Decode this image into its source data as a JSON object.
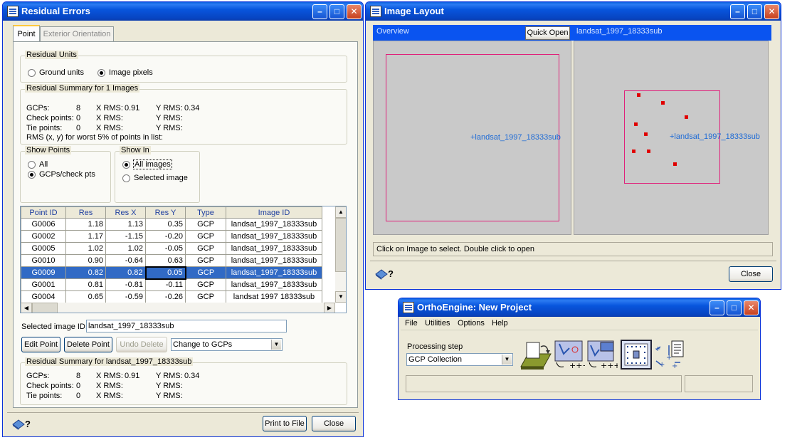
{
  "residual_window": {
    "title": "Residual Errors",
    "tabs": [
      "Point",
      "Exterior Orientation"
    ],
    "residual_units": {
      "label": "Residual Units",
      "options": [
        "Ground units",
        "Image pixels"
      ],
      "selected": "Image pixels"
    },
    "summary": {
      "label": "Residual Summary for 1 Images",
      "rows": [
        {
          "name": "GCPs:",
          "count": "8",
          "xrms": "X RMS:",
          "xval": "0.91",
          "yrms": "Y RMS:",
          "yval": "0.34"
        },
        {
          "name": "Check points:",
          "count": "0",
          "xrms": "X RMS:",
          "xval": "",
          "yrms": "Y RMS:",
          "yval": ""
        },
        {
          "name": "Tie points:",
          "count": "0",
          "xrms": "X RMS:",
          "xval": "",
          "yrms": "Y RMS:",
          "yval": ""
        }
      ],
      "worst_note": "RMS (x, y) for worst 5% of points in list:"
    },
    "show_points": {
      "label": "Show Points",
      "options": [
        "All",
        "GCPs/check pts"
      ],
      "selected": "GCPs/check pts"
    },
    "show_in": {
      "label": "Show In",
      "options": [
        "All images",
        "Selected image"
      ],
      "selected": "All images"
    },
    "table": {
      "columns": [
        "Point ID",
        "Res",
        "Res X",
        "Res Y",
        "Type",
        "Image ID"
      ],
      "rows": [
        [
          "G0006",
          "1.18",
          "1.13",
          "0.35",
          "GCP",
          "landsat_1997_18333sub"
        ],
        [
          "G0002",
          "1.17",
          "-1.15",
          "-0.20",
          "GCP",
          "landsat_1997_18333sub"
        ],
        [
          "G0005",
          "1.02",
          "1.02",
          "-0.05",
          "GCP",
          "landsat_1997_18333sub"
        ],
        [
          "G0010",
          "0.90",
          "-0.64",
          "0.63",
          "GCP",
          "landsat_1997_18333sub"
        ],
        [
          "G0009",
          "0.82",
          "0.82",
          "0.05",
          "GCP",
          "landsat_1997_18333sub"
        ],
        [
          "G0001",
          "0.81",
          "-0.81",
          "-0.11",
          "GCP",
          "landsat_1997_18333sub"
        ],
        [
          "G0004",
          "0.65",
          "-0.59",
          "-0.26",
          "GCP",
          "landsat 1997 18333sub"
        ]
      ],
      "selected_row": 4
    },
    "selected_image_label": "Selected image ID:",
    "selected_image_value": "landsat_1997_18333sub",
    "buttons": {
      "edit": "Edit Point",
      "delete": "Delete Point",
      "undo": "Undo Delete",
      "print": "Print to File",
      "close": "Close"
    },
    "change_combo": "Change to GCPs",
    "image_summary": {
      "label": "Residual Summary for landsat_1997_18333sub",
      "rows": [
        {
          "name": "GCPs:",
          "count": "8",
          "xrms": "X RMS:",
          "xval": "0.91",
          "yrms": "Y RMS:",
          "yval": "0.34"
        },
        {
          "name": "Check points:",
          "count": "0",
          "xrms": "X RMS:",
          "xval": "",
          "yrms": "Y RMS:",
          "yval": ""
        },
        {
          "name": "Tie points:",
          "count": "0",
          "xrms": "X RMS:",
          "xval": "",
          "yrms": "Y RMS:",
          "yval": ""
        }
      ]
    }
  },
  "layout_window": {
    "title": "Image Layout",
    "overview_label": "Overview",
    "quick_open": "Quick Open",
    "image_name": "landsat_1997_18333sub",
    "overview_image_label": "+landsat_1997_18333sub",
    "detail_image_label": "+landsat_1997_18333sub",
    "status": "Click on Image to select. Double click to open",
    "close": "Close"
  },
  "ortho_window": {
    "title": "OrthoEngine: New Project",
    "menu": [
      "File",
      "Utilities",
      "Options",
      "Help"
    ],
    "processing_label": "Processing step",
    "processing_value": "GCP Collection"
  },
  "colors": {
    "title_bar": "#0855DD",
    "selection": "#316AC5",
    "footprint": "#E0207A",
    "gcp_point": "#E00000",
    "link_text": "#1E6BD6"
  },
  "icons": [
    "window-app-icon",
    "help-book-icon",
    "open-image-icon",
    "gcp-collect-icon",
    "gcp-import-icon",
    "points-grid-icon",
    "transform-icon",
    "report-icon"
  ]
}
